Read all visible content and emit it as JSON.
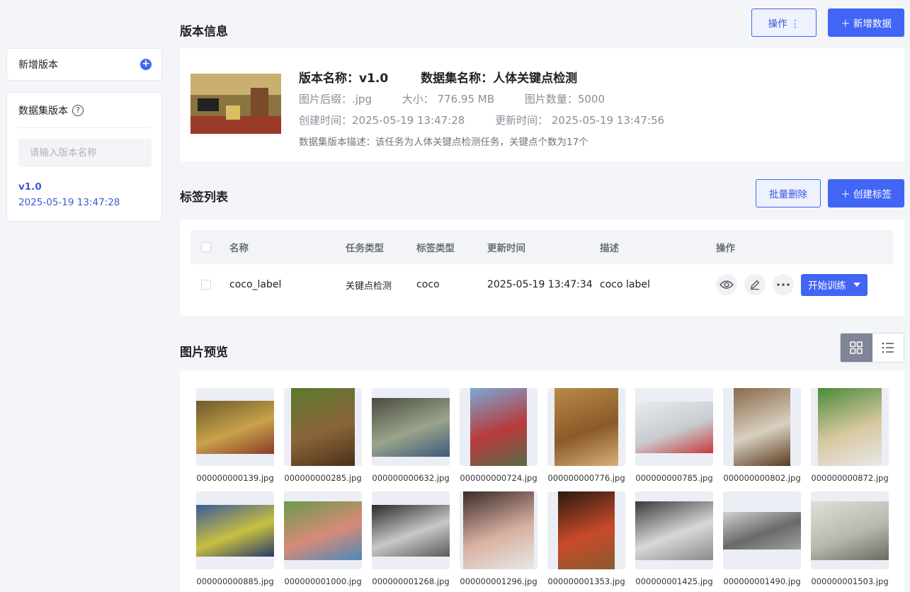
{
  "sidebar": {
    "new_version": "新增版本",
    "versions_title": "数据集版本",
    "search_placeholder": "请输入版本名称",
    "version_name": "v1.0",
    "version_time": "2025-05-19 13:47:28"
  },
  "header": {
    "version_info_title": "版本信息",
    "ops_button": "操作 ⋮",
    "add_data_button": "＋ 新增数据"
  },
  "info": {
    "version_name": "版本名称：v1.0",
    "dataset_name": "数据集名称：人体关键点检测",
    "suffix": "图片后缀：.jpg",
    "size": "大小：  776.95 MB",
    "count": "图片数量：5000",
    "created": "创建时间：2025-05-19 13:47:28",
    "updated": "更新时间：  2025-05-19 13:47:56",
    "description": "数据集版本描述：该任务为人体关键点检测任务，关键点个数为17个"
  },
  "labels": {
    "title": "标签列表",
    "batch_delete": "批量删除",
    "create_label": "＋ 创建标签",
    "columns": [
      "名称",
      "任务类型",
      "标签类型",
      "更新时间",
      "描述",
      "操作"
    ],
    "rows": [
      {
        "name": "coco_label",
        "task": "关键点检测",
        "type": "coco",
        "updated": "2025-05-19 13:47:34",
        "desc": "coco label",
        "train": "开始训练"
      }
    ]
  },
  "preview": {
    "title": "图片预览",
    "images": [
      {
        "file": "000000000139.jpg",
        "colors": [
          "#6b5a2a",
          "#c9a24a",
          "#8a3d2a"
        ],
        "h": 75
      },
      {
        "file": "000000000285.jpg",
        "colors": [
          "#5a7a30",
          "#8a6438",
          "#4a3018"
        ],
        "h": 110
      },
      {
        "file": "000000000632.jpg",
        "colors": [
          "#4a4c40",
          "#9aa48a",
          "#3a5a7a"
        ],
        "h": 83
      },
      {
        "file": "000000000724.jpg",
        "colors": [
          "#7aa8d8",
          "#b83a3a",
          "#5a6a4a"
        ],
        "h": 110
      },
      {
        "file": "000000000776.jpg",
        "colors": [
          "#b88a4a",
          "#8a5a28",
          "#d8b078"
        ],
        "h": 110
      },
      {
        "file": "000000000785.jpg",
        "colors": [
          "#e8ecef",
          "#c8ccd0",
          "#c83a3a"
        ],
        "h": 73
      },
      {
        "file": "000000000802.jpg",
        "colors": [
          "#8a6a4a",
          "#d8d0c0",
          "#5a3a20"
        ],
        "h": 110
      },
      {
        "file": "000000000872.jpg",
        "colors": [
          "#4a8a3a",
          "#d8c8a0",
          "#e8e8e8"
        ],
        "h": 110
      },
      {
        "file": "000000000885.jpg",
        "colors": [
          "#3a5a9a",
          "#c8c040",
          "#2a3a6a"
        ],
        "h": 73
      },
      {
        "file": "000000001000.jpg",
        "colors": [
          "#6a9a4a",
          "#d88a7a",
          "#4a8ab8"
        ],
        "h": 83
      },
      {
        "file": "000000001268.jpg",
        "colors": [
          "#2a2a2a",
          "#c8c8c8",
          "#5a5a5a"
        ],
        "h": 73
      },
      {
        "file": "000000001296.jpg",
        "colors": [
          "#3a2a2a",
          "#d8b0a0",
          "#e8e8e8"
        ],
        "h": 110
      },
      {
        "file": "000000001353.jpg",
        "colors": [
          "#2a1a10",
          "#c84a2a",
          "#8a5a30"
        ],
        "h": 110
      },
      {
        "file": "000000001425.jpg",
        "colors": [
          "#3a3a3a",
          "#d8d8d8",
          "#8a8a8a"
        ],
        "h": 83
      },
      {
        "file": "000000001490.jpg",
        "colors": [
          "#d0d0d0",
          "#6a6a6a",
          "#a0a0a0"
        ],
        "h": 53
      },
      {
        "file": "000000001503.jpg",
        "colors": [
          "#e0e0d8",
          "#b8b8b0",
          "#6a6a60"
        ],
        "h": 83
      }
    ]
  }
}
